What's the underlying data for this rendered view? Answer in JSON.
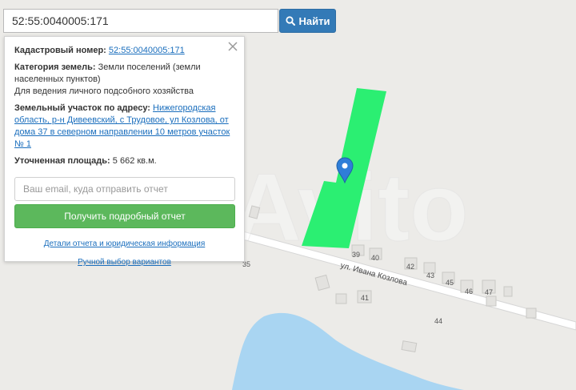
{
  "search": {
    "value": "52:55:0040005:171",
    "button_label": "Найти"
  },
  "popup": {
    "cadastral_label": "Кадастровый номер:",
    "cadastral_value": "52:55:0040005:171",
    "category_label": "Категория земель:",
    "category_value": "Земли поселений (земли населенных пунктов)",
    "usage": "Для ведения личного подсобного хозяйства",
    "address_label": "Земельный участок по адресу:",
    "address_value": "Нижегородская область, р-н Дивеевский, с Трудовое, ул Козлова, от дома 37 в северном направлении 10 метров участок № 1",
    "area_label": "Уточненная площадь:",
    "area_value": "5 662 кв.м.",
    "email_placeholder": "Ваш email, куда отправить отчет",
    "report_button": "Получить подробный отчет",
    "details_link": "Детали отчета и юридическая информация",
    "manual_link": "Ручной выбор вариантов"
  },
  "map": {
    "street_name": "ул. Ивана Козлова",
    "house_numbers": [
      "35",
      "39",
      "40",
      "41",
      "42",
      "43",
      "45",
      "46",
      "47",
      "44"
    ],
    "watermark": "Avito",
    "colors": {
      "background": "#ecebe8",
      "parcel": "#2bef72",
      "water": "#a9d5f2",
      "marker": "#2f7ed8"
    }
  }
}
